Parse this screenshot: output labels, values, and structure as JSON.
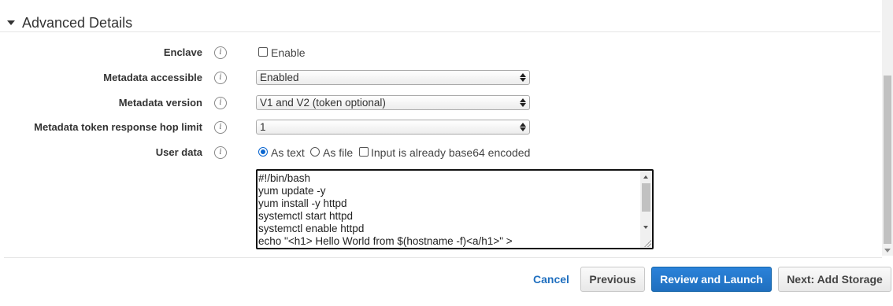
{
  "section": {
    "title": "Advanced Details"
  },
  "rows": {
    "enclave": {
      "label": "Enclave",
      "checkbox_label": "Enable",
      "checked": false
    },
    "metadata_accessible": {
      "label": "Metadata accessible",
      "value": "Enabled"
    },
    "metadata_version": {
      "label": "Metadata version",
      "value": "V1 and V2 (token optional)"
    },
    "hop_limit": {
      "label": "Metadata token response hop limit",
      "value": "1"
    },
    "user_data": {
      "label": "User data",
      "options": [
        "As text",
        "As file"
      ],
      "selected": "As text",
      "base64_label": "Input is already base64 encoded",
      "base64_checked": false,
      "lines": [
        "#!/bin/bash",
        "yum update -y",
        "yum install -y httpd",
        "systemctl start httpd",
        "systemctl enable httpd",
        "echo \"<h1> Hello World from $(hostname -f)<a/h1>\" >"
      ]
    }
  },
  "info_glyph": "i",
  "icons": {
    "info": "info-circle-icon",
    "collapse": "caret-down-icon"
  },
  "footer": {
    "cancel": "Cancel",
    "previous": "Previous",
    "review_launch": "Review and Launch",
    "next": "Next: Add Storage"
  },
  "colors": {
    "primary": "#1f6fbf",
    "link": "#1f6fbf",
    "radio": "#0a66d0"
  }
}
